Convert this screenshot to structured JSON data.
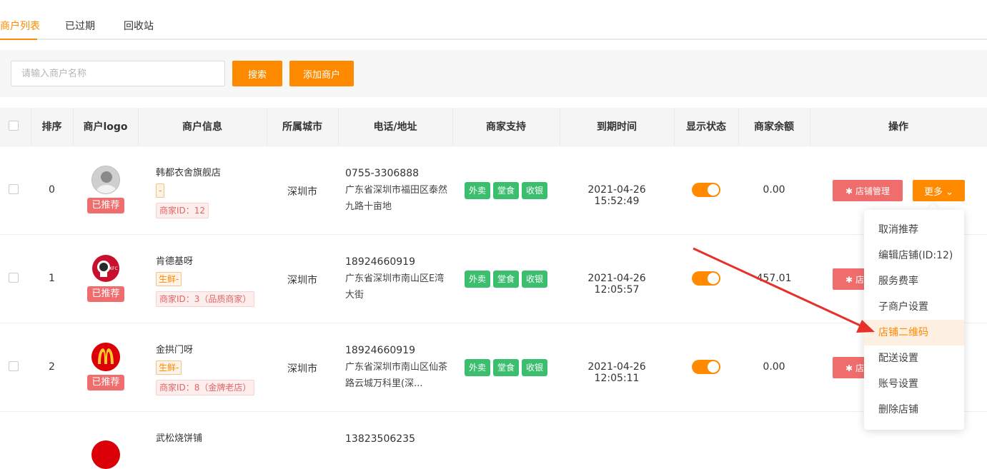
{
  "tabs": [
    {
      "label": "商户列表",
      "active": true
    },
    {
      "label": "已过期",
      "active": false
    },
    {
      "label": "回收站",
      "active": false
    }
  ],
  "toolbar": {
    "search_placeholder": "请输入商户名称",
    "search_label": "搜索",
    "add_label": "添加商户"
  },
  "table": {
    "headers": [
      "排序",
      "商户logo",
      "商户信息",
      "所属城市",
      "电话/地址",
      "商家支持",
      "到期时间",
      "显示状态",
      "商家余额",
      "操作"
    ],
    "rows": [
      {
        "sort": "0",
        "logo_icon": "user-avatar-icon",
        "badge": "已推荐",
        "name": "韩都衣舍旗舰店",
        "category": "-",
        "merchant_id": "商家ID：12",
        "city": "深圳市",
        "phone": "0755-3306888",
        "address": "广东省深圳市福田区泰然九路十亩地",
        "supports": [
          "外卖",
          "堂食",
          "收银"
        ],
        "expire": "2021-04-26 15:52:49",
        "display_on": true,
        "balance": "0.00"
      },
      {
        "sort": "1",
        "logo_icon": "kfc-logo-icon",
        "badge": "已推荐",
        "name": "肯德基呀",
        "category": "生鲜-",
        "merchant_id": "商家ID：3（品质商家）",
        "city": "深圳市",
        "phone": "18924660919",
        "address": "广东省深圳市南山区E湾大街",
        "supports": [
          "外卖",
          "堂食",
          "收银"
        ],
        "expire": "2021-04-26 12:05:57",
        "display_on": true,
        "balance": "457.01"
      },
      {
        "sort": "2",
        "logo_icon": "mcdonalds-logo-icon",
        "badge": "已推荐",
        "name": "金拱门呀",
        "category": "生鲜-",
        "merchant_id": "商家ID：8（金牌老店）",
        "city": "深圳市",
        "phone": "18924660919",
        "address": "广东省深圳市南山区仙茶路云城万科里(深...",
        "supports": [
          "外卖",
          "堂食",
          "收银"
        ],
        "expire": "2021-04-26 12:05:11",
        "display_on": true,
        "balance": "0.00"
      },
      {
        "name": "武松烧饼铺",
        "phone": "13823506235"
      }
    ],
    "manage_label": "店铺管理",
    "more_label": "更多"
  },
  "dropdown": {
    "items": [
      "取消推荐",
      "编辑店铺(ID:12)",
      "服务费率",
      "子商户设置",
      "店铺二维码",
      "配送设置",
      "账号设置",
      "删除店铺"
    ],
    "active_index": 4
  },
  "colors": {
    "accent": "#ff8a00",
    "recommend": "#f06d6d",
    "support": "#3bbf6f",
    "annotation_arrow": "#e8302a"
  }
}
